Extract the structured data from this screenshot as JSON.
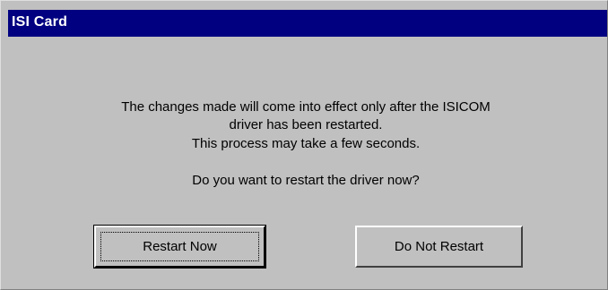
{
  "dialog": {
    "title": "ISI Card",
    "message_lines": [
      "The changes made will come into  effect only after the ISICOM",
      "driver has been restarted.",
      "This process may take a few seconds.",
      "Do you want to restart the driver now?"
    ],
    "buttons": {
      "restart_now": "Restart Now",
      "do_not_restart": "Do Not Restart"
    }
  },
  "colors": {
    "titlebar": "#000080",
    "face": "#c0c0c0",
    "title_text": "#ffffff"
  }
}
